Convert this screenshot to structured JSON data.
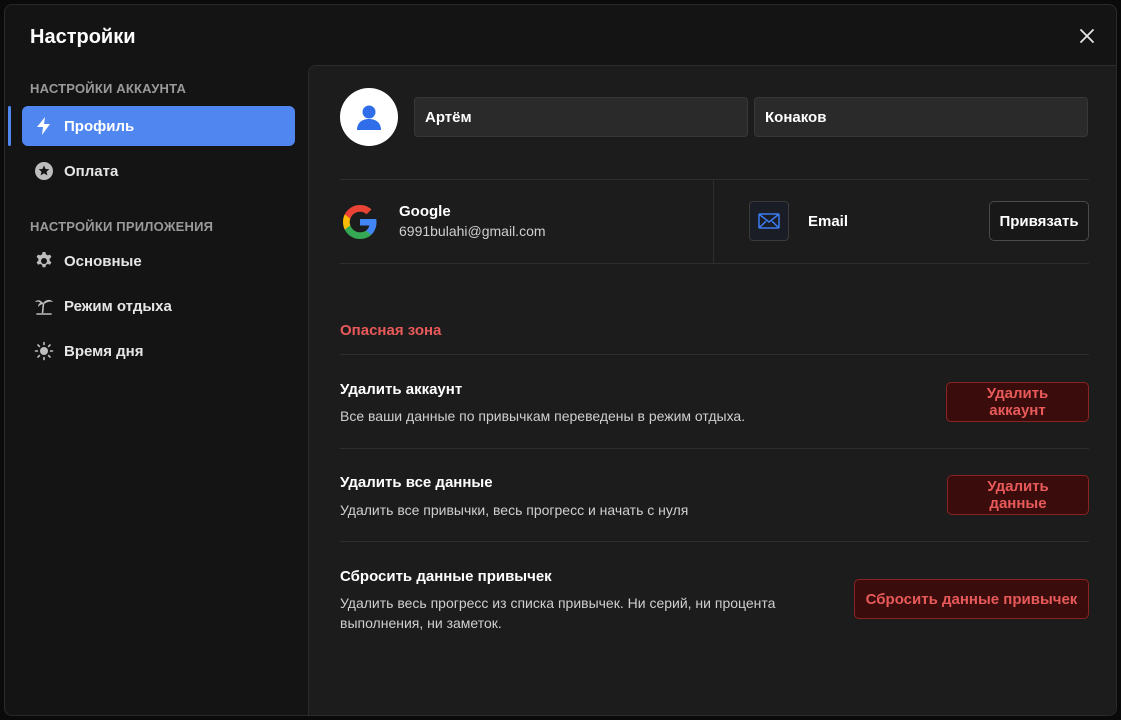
{
  "window": {
    "title": "Настройки"
  },
  "sidebar": {
    "account_section": "НАСТРОЙКИ АККАУНТА",
    "app_section": "НАСТРОЙКИ ПРИЛОЖЕНИЯ",
    "items": [
      {
        "label": "Профиль",
        "icon": "bolt-icon",
        "active": true
      },
      {
        "label": "Оплата",
        "icon": "star-icon"
      },
      {
        "label": "Основные",
        "icon": "gear-icon"
      },
      {
        "label": "Режим отдыха",
        "icon": "palm-tree-icon"
      },
      {
        "label": "Время дня",
        "icon": "sun-icon"
      }
    ]
  },
  "profile": {
    "first_name": "Артём",
    "last_name": "Конаков"
  },
  "accounts": {
    "google": {
      "name": "Google",
      "email": "6991bulahi@gmail.com"
    },
    "email": {
      "name": "Email",
      "button": "Привязать"
    }
  },
  "danger_zone": {
    "title": "Опасная зона",
    "rows": [
      {
        "title": "Удалить аккаунт",
        "description": "Все ваши данные по привычкам переведены в режим отдыха.",
        "button": "Удалить аккаунт"
      },
      {
        "title": "Удалить все данные",
        "description": "Удалить все привычки, весь прогресс и начать с нуля",
        "button": "Удалить данные"
      },
      {
        "title": "Сбросить данные привычек",
        "description": "Удалить весь прогресс из списка привычек. Ни серий, ни процента выполнения, ни заметок.",
        "button": "Сбросить данные привычек"
      }
    ]
  },
  "colors": {
    "accent": "#4f86f0",
    "danger": "#e85a5a",
    "background": "#141414",
    "panel": "#1c1c1c"
  }
}
